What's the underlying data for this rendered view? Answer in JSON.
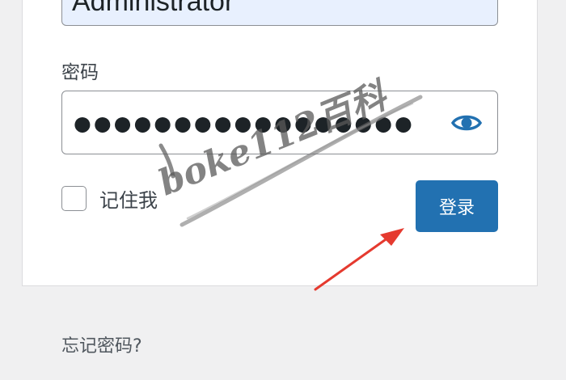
{
  "form": {
    "username_value": "Administrator",
    "password_label": "密码",
    "password_dots": "●●●●●●●●●●●●●●●●●",
    "remember_label": "记住我",
    "login_button_label": "登录",
    "forgot_password_label": "忘记密码?"
  },
  "watermark": {
    "text": "boke112百科"
  },
  "colors": {
    "background": "#f0f0f1",
    "card": "#ffffff",
    "primary_button": "#2271b1",
    "username_fill": "#e8f0fe",
    "arrow": "#e53a2f"
  },
  "icons": {
    "show_password": "eye-icon",
    "pointer": "red-arrow-icon"
  }
}
